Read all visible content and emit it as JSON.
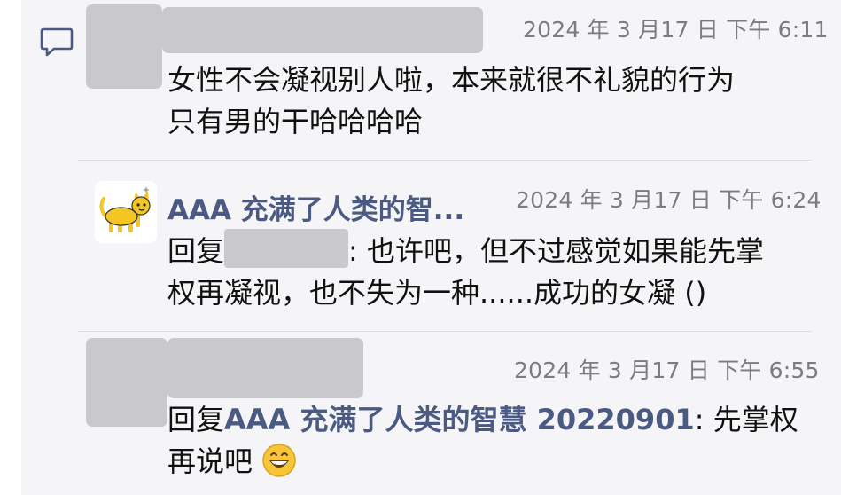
{
  "comments": [
    {
      "timestamp": "2024 年 3 月17 日 下午 6:11",
      "lines": [
        "女性不会凝视别人啦，本来就很不礼貌的行为",
        "只有男的干哈哈哈哈"
      ]
    },
    {
      "username": "AAA 充满了人类的智...",
      "timestamp": "2024 年 3 月17 日 下午 6:24",
      "reply_prefix": "回复",
      "line1_rest": ": 也许吧，但不过感觉如果能先掌",
      "line2": "权再凝视，也不失为一种......成功的女凝 ()"
    },
    {
      "timestamp": "2024 年 3 月17 日 下午 6:55",
      "reply_prefix": "回复",
      "mention": "AAA 充满了人类的智慧 20220901",
      "line1_rest": ": 先掌权",
      "line2": "再说吧"
    }
  ],
  "icons": {
    "comment": "comment-bubble-icon",
    "avatar": "cat-avatar",
    "emoji": "grinning-face-emoji"
  },
  "colors": {
    "mention": "#4b5a82",
    "timestamp": "#7b7b80",
    "background": "#f5f5f7",
    "redaction": "#c9c9cd"
  }
}
